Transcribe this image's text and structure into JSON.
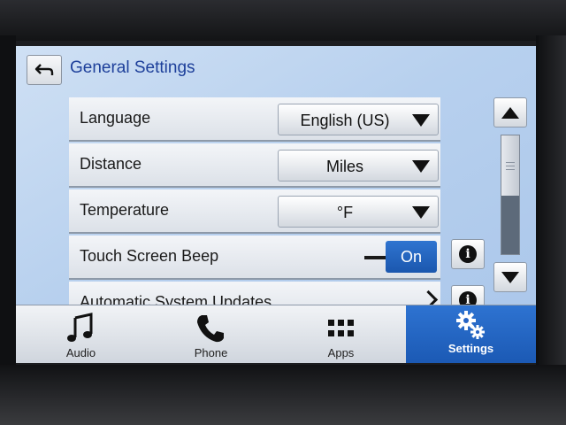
{
  "header": {
    "title": "General Settings",
    "back_icon": "back-arrow-icon"
  },
  "settings": [
    {
      "label": "Language",
      "control": "dropdown",
      "value": "English (US)"
    },
    {
      "label": "Distance",
      "control": "dropdown",
      "value": "Miles"
    },
    {
      "label": "Temperature",
      "control": "dropdown",
      "value": "°F"
    },
    {
      "label": "Touch Screen Beep",
      "control": "toggle",
      "value": "On",
      "info": true
    },
    {
      "label": "Automatic System Updates",
      "control": "chevron",
      "info": true
    }
  ],
  "info_icon_glyph": "i",
  "nav": [
    {
      "label": "Audio",
      "icon": "music-note-icon"
    },
    {
      "label": "Phone",
      "icon": "phone-icon"
    },
    {
      "label": "Apps",
      "icon": "apps-grid-icon"
    },
    {
      "label": "Settings",
      "icon": "gears-icon",
      "active": true
    }
  ],
  "colors": {
    "accent": "#1f5fbf",
    "title_text": "#1d3f9a",
    "screen_bg": "#b7d0ee"
  }
}
